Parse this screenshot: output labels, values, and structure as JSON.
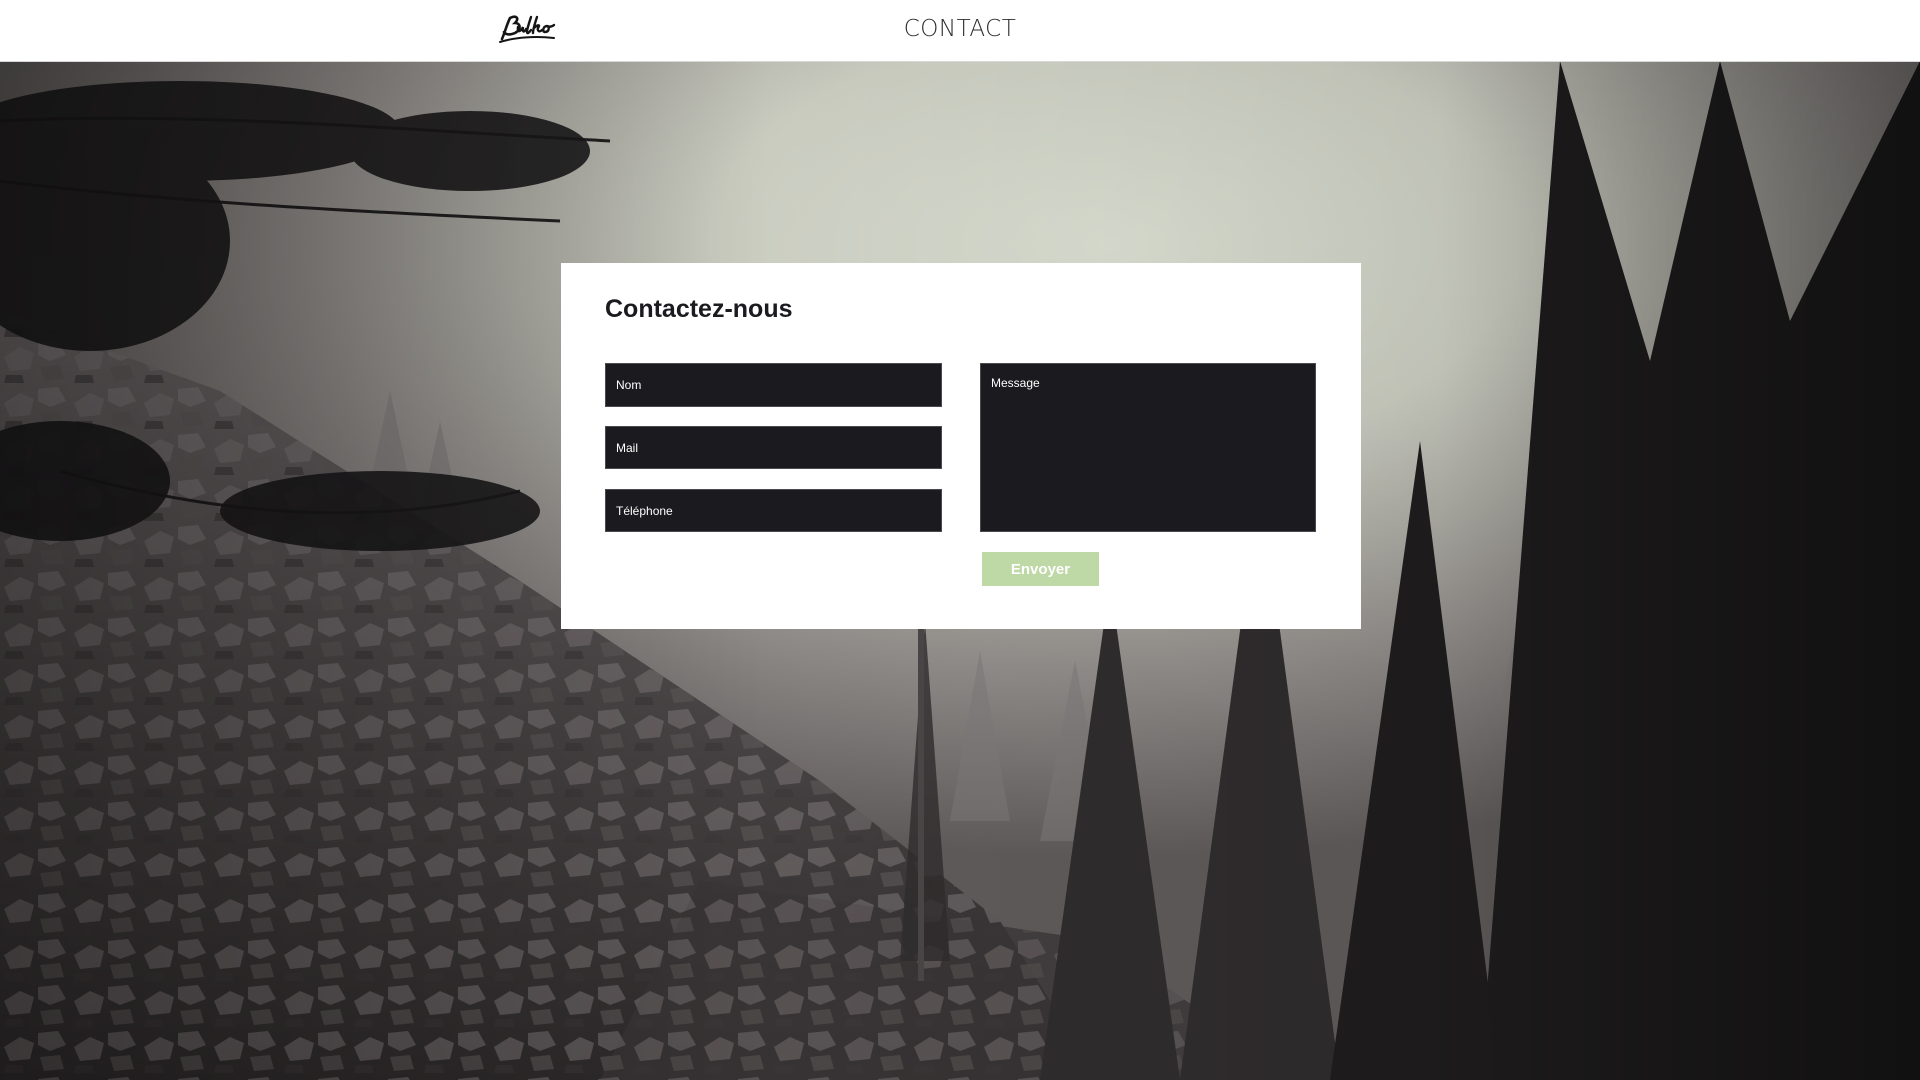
{
  "header": {
    "logo_text": "Bulko",
    "nav_title": "CONTACT"
  },
  "contact_form": {
    "title": "Contactez-nous",
    "name_placeholder": "Nom",
    "mail_placeholder": "Mail",
    "phone_placeholder": "Téléphone",
    "message_placeholder": "Message",
    "submit_label": "Envoyer"
  },
  "colors": {
    "header_bg": "#ffffff",
    "field_bg": "#1b1a1f",
    "submit_bg": "#bed8a6",
    "card_bg": "#ffffff"
  },
  "background": {
    "icon": "misty-forest-scree-photo"
  }
}
